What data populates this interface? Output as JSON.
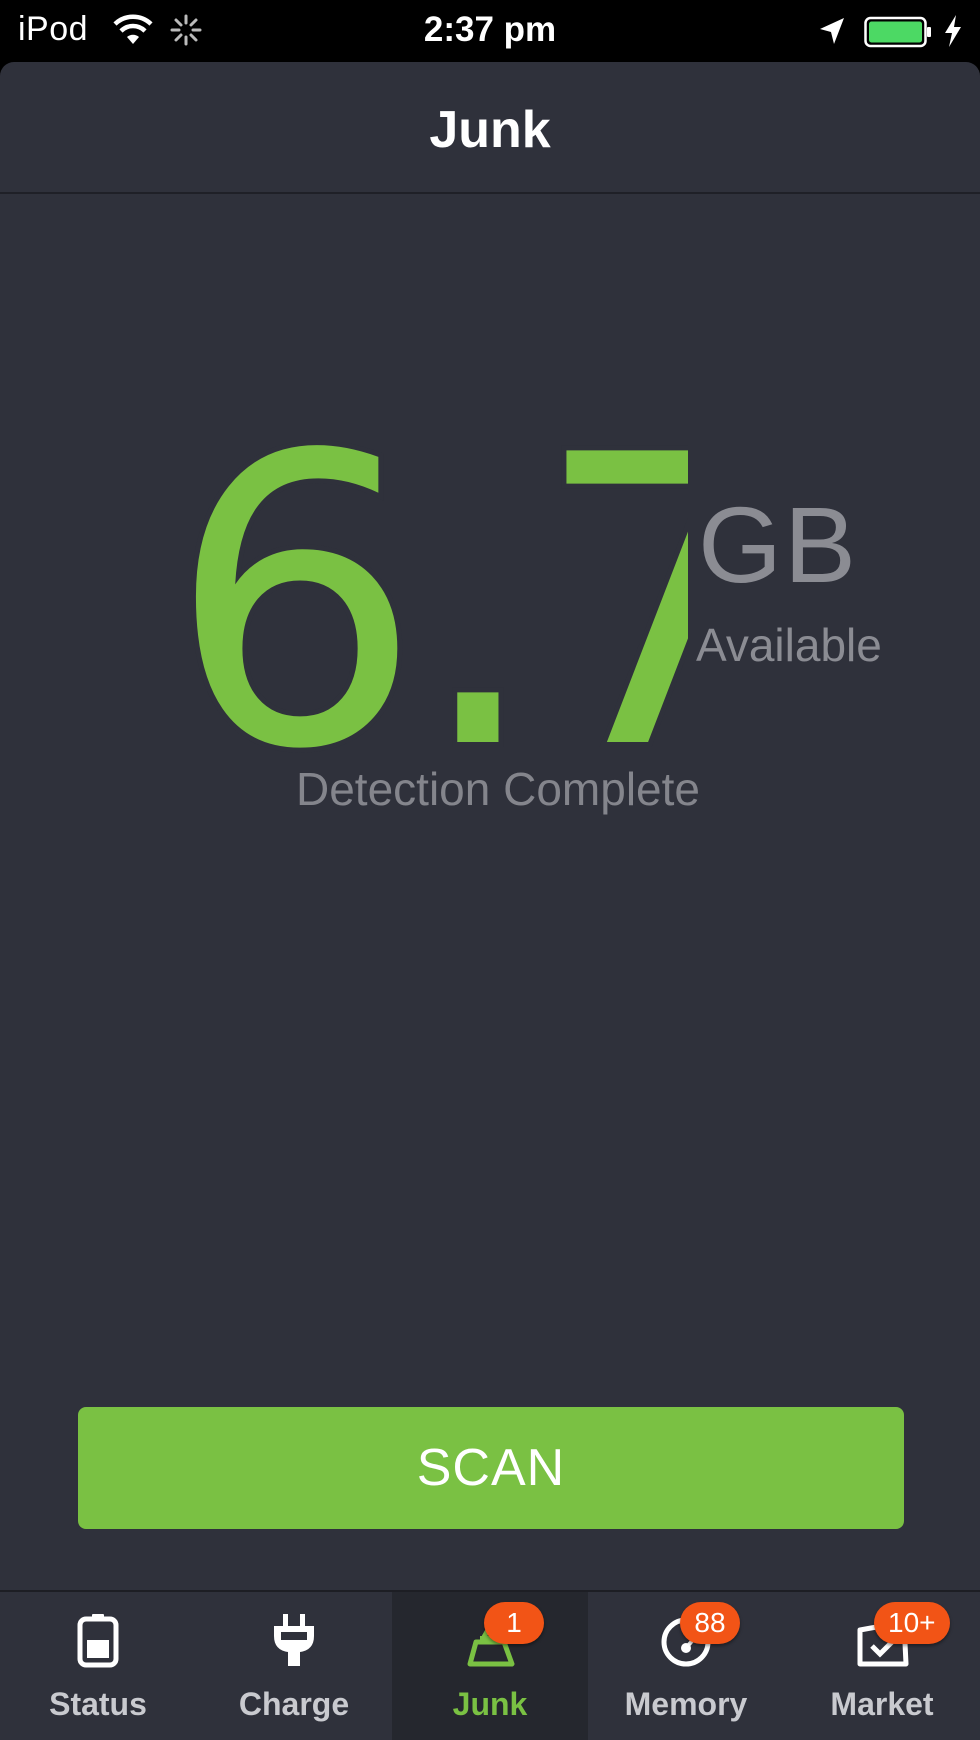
{
  "status_bar": {
    "carrier": "iPod",
    "time": "2:37 pm",
    "icons": [
      "wifi-icon",
      "activity-spinner-icon",
      "location-arrow-icon",
      "battery-icon",
      "charging-bolt-icon"
    ],
    "battery_level": 1.0,
    "battery_color": "#4cd964"
  },
  "nav": {
    "title": "Junk"
  },
  "main": {
    "value": "6.7",
    "unit": "GB",
    "unit_caption": "Available",
    "status": "Detection Complete"
  },
  "scan_button": {
    "label": "SCAN"
  },
  "tabs": [
    {
      "label": "Status",
      "icon": "battery-status-icon",
      "badge": ""
    },
    {
      "label": "Charge",
      "icon": "plug-icon",
      "badge": ""
    },
    {
      "label": "Junk",
      "icon": "broom-icon",
      "badge": "1",
      "active": true
    },
    {
      "label": "Memory",
      "icon": "memory-gauge-icon",
      "badge": "88"
    },
    {
      "label": "Market",
      "icon": "market-bag-icon",
      "badge": "10+"
    }
  ],
  "colors": {
    "accent": "#7ac143",
    "background": "#2f313b",
    "badge": "#f25416",
    "muted_text": "#8b8c93"
  }
}
